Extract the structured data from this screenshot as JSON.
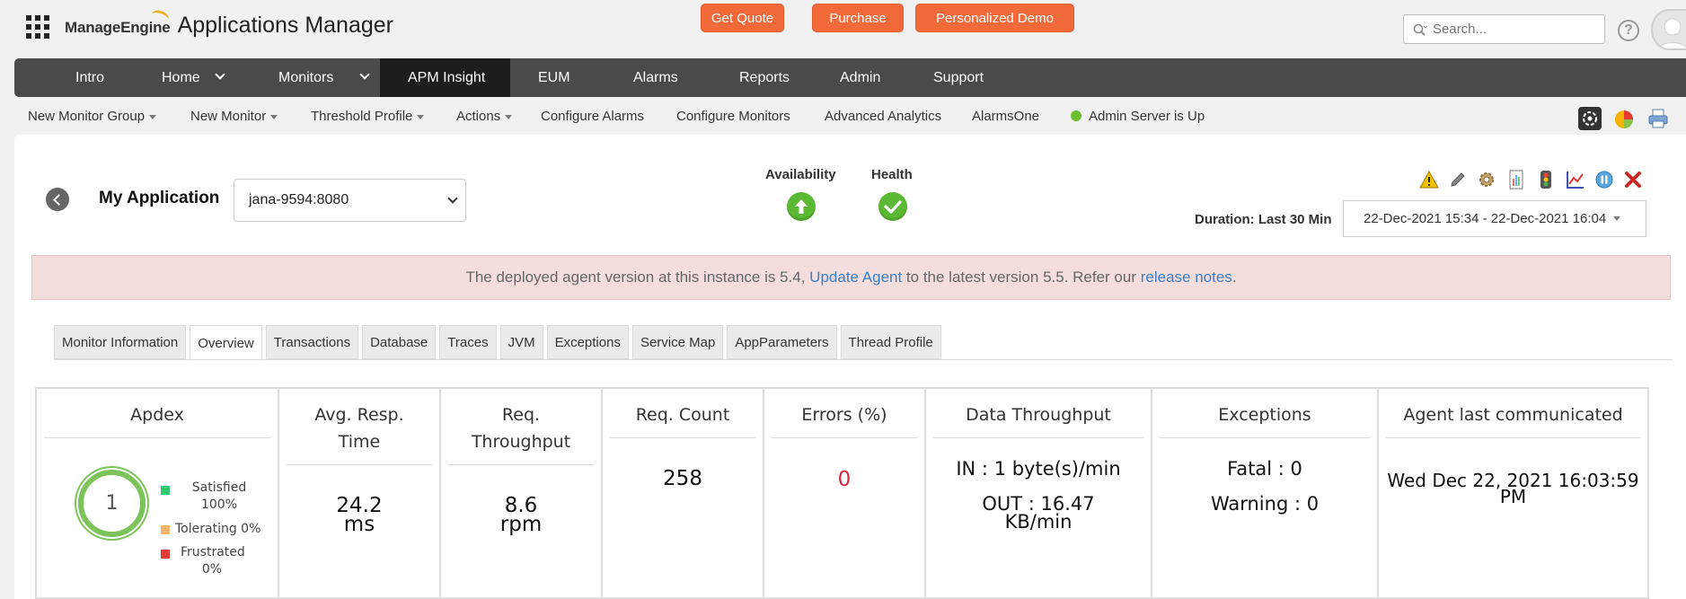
{
  "header": {
    "brand_company": "ManageEngine",
    "brand_product": "Applications Manager",
    "buttons": [
      "Get Quote",
      "Purchase",
      "Personalized Demo"
    ],
    "search_placeholder": "Search...",
    "help_label": "?"
  },
  "nav": {
    "items": [
      {
        "label": "Intro",
        "dropdown": false
      },
      {
        "label": "Home",
        "dropdown": true
      },
      {
        "label": "Monitors",
        "dropdown": true
      },
      {
        "label": "APM Insight",
        "dropdown": false,
        "active": true
      },
      {
        "label": "EUM",
        "dropdown": false
      },
      {
        "label": "Alarms",
        "dropdown": false
      },
      {
        "label": "Reports",
        "dropdown": false
      },
      {
        "label": "Admin",
        "dropdown": false
      },
      {
        "label": "Support",
        "dropdown": false
      }
    ]
  },
  "subnav": {
    "items": [
      "New Monitor Group",
      "New Monitor",
      "Threshold Profile",
      "Actions",
      "Configure Alarms",
      "Configure Monitors",
      "Advanced Analytics",
      "AlarmsOne"
    ],
    "server_status": "Admin Server is Up"
  },
  "monitor": {
    "title": "My Application",
    "selected_instance": "jana-9594:8080",
    "availability_label": "Availability",
    "health_label": "Health",
    "duration_label": "Duration: Last 30 Min",
    "duration_value": "22-Dec-2021 15:34 - 22-Dec-2021 16:04"
  },
  "banner": {
    "text_1": "The deployed agent version at this instance is 5.4, ",
    "link_1": "Update Agent",
    "text_2": " to the latest version 5.5. Refer our ",
    "link_2": "release notes",
    "text_3": "."
  },
  "tabs": [
    "Monitor Information",
    "Overview",
    "Transactions",
    "Database",
    "Traces",
    "JVM",
    "Exceptions",
    "Service Map",
    "AppParameters",
    "Thread Profile"
  ],
  "active_tab": "Overview",
  "metrics": {
    "apdex": {
      "title": "Apdex",
      "score": "1",
      "satisfied": "Satisfied",
      "satisfied_pct": "100%",
      "tolerating": "Tolerating 0%",
      "frustrated": "Frustrated",
      "frustrated_pct": "0%"
    },
    "avg_resp": {
      "title_1": "Avg. Resp.",
      "title_2": "Time",
      "value": "24.2",
      "unit": "ms"
    },
    "throughput": {
      "title_1": "Req.",
      "title_2": "Throughput",
      "value": "8.6",
      "unit": "rpm"
    },
    "req_count": {
      "title": "Req. Count",
      "value": "258"
    },
    "errors": {
      "title": "Errors (%)",
      "value": "0"
    },
    "data_throughput": {
      "title": "Data Throughput",
      "in": "IN : 1 byte(s)/min",
      "out_1": "OUT : 16.47",
      "out_2": "KB/min"
    },
    "exceptions": {
      "title": "Exceptions",
      "fatal": "Fatal : 0",
      "warning": "Warning : 0"
    },
    "agent": {
      "title": "Agent last communicated",
      "value_1": "Wed Dec 22, 2021 16:03:59",
      "value_2": "PM"
    }
  },
  "colors": {
    "cta": "#f26a3a",
    "nav_bg": "#4a4a4a",
    "nav_active": "#1d1d1d",
    "status_green": "#5bb832",
    "banner_bg": "#f4dedd",
    "link": "#3b7dc8",
    "error_red": "#d7263d"
  }
}
